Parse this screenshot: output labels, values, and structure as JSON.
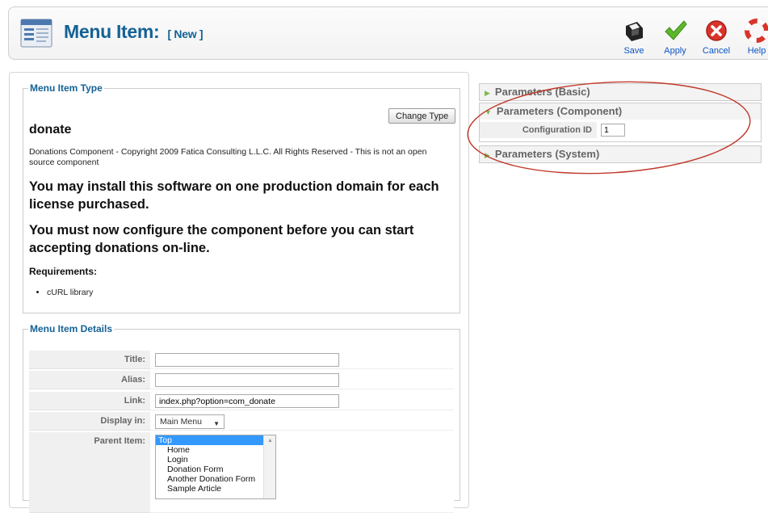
{
  "header": {
    "title": "Menu Item:",
    "tag": "[ New ]",
    "icon": "menu-manager-icon"
  },
  "toolbar": {
    "buttons": [
      {
        "label": "Save",
        "icon": "save-icon"
      },
      {
        "label": "Apply",
        "icon": "check-icon"
      },
      {
        "label": "Cancel",
        "icon": "cancel-icon"
      },
      {
        "label": "Help",
        "icon": "help-lifebuoy-icon"
      }
    ]
  },
  "menu_item_type": {
    "legend": "Menu Item Type",
    "change_type_label": "Change Type",
    "name": "donate",
    "description": "Donations Component - Copyright 2009 Fatica Consulting L.L.C. All Rights Reserved - This is not an open source component",
    "license_note": "You may install this software on one production domain for each license purchased.",
    "configure_note": "You must now configure the component before you can start accepting donations on-line.",
    "requirements_label": "Requirements:",
    "requirements": [
      "cURL library"
    ]
  },
  "details": {
    "legend": "Menu Item Details",
    "title_label": "Title:",
    "title_value": "",
    "alias_label": "Alias:",
    "alias_value": "",
    "link_label": "Link:",
    "link_value": "index.php?option=com_donate",
    "display_label": "Display in:",
    "display_value": "Main Menu",
    "parent_label": "Parent Item:",
    "parent_options": [
      "Top",
      "Home",
      "Login",
      "Donation Form",
      "Another Donation Form",
      "Sample Article"
    ],
    "parent_selected": "Top"
  },
  "parameters": {
    "basic_label": "Parameters (Basic)",
    "component_label": "Parameters (Component)",
    "system_label": "Parameters (System)",
    "config_id_label": "Configuration ID",
    "config_id_value": "1"
  },
  "colors": {
    "title_blue": "#146295",
    "annotation_red": "#c0392b",
    "selected_blue": "#3399ff"
  }
}
